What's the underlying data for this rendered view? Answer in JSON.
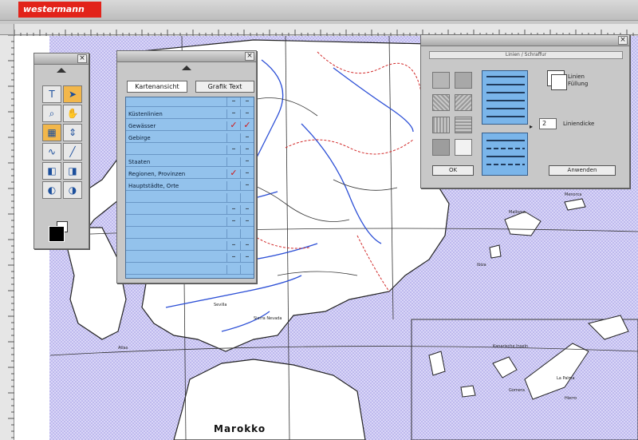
{
  "app": {
    "logo_text": "westermann",
    "brand_color": "#e2231a"
  },
  "map": {
    "label_morocco": "Marokko",
    "label_sevilla": "Sevilla",
    "label_sierra": "Sierra Nevada",
    "label_atlas": "Atlas",
    "label_canary": "Kanarische Inseln",
    "label_la_palma": "La Palma",
    "label_gomera": "Gomera",
    "label_hierro": "Hierro",
    "label_mallorca": "Mallorca",
    "label_menorca": "Menorca",
    "label_ibiza": "Ibiza",
    "hatch_color": "#c7c2f2",
    "river_color": "#2c4fd6",
    "border_color": "#d22b2b"
  },
  "tools_panel": {
    "close": "×",
    "tools": [
      {
        "name": "text-tool-icon",
        "glyph": "T",
        "active": false
      },
      {
        "name": "pointer-tool-icon",
        "glyph": "➤",
        "active": true
      },
      {
        "name": "zoom-tool-icon",
        "glyph": "⌕",
        "active": false
      },
      {
        "name": "hand-tool-icon",
        "glyph": "✋",
        "active": false
      },
      {
        "name": "grid-tool-icon",
        "glyph": "▦",
        "active": true
      },
      {
        "name": "move-tool-icon",
        "glyph": "⇕",
        "active": false
      },
      {
        "name": "curve-tool-icon",
        "glyph": "∿",
        "active": false
      },
      {
        "name": "line-tool-icon",
        "glyph": "╱",
        "active": false
      },
      {
        "name": "fill-left-tool-icon",
        "glyph": "◧",
        "active": false
      },
      {
        "name": "fill-right-tool-icon",
        "glyph": "◨",
        "active": false
      },
      {
        "name": "contrast-left-tool-icon",
        "glyph": "◐",
        "active": false
      },
      {
        "name": "contrast-right-tool-icon",
        "glyph": "◑",
        "active": false
      }
    ]
  },
  "layers_panel": {
    "close": "×",
    "tab_map": "Kartenansicht",
    "tab_graphic": "Grafik Text",
    "rows": [
      {
        "label": "",
        "c1": "–",
        "c2": "–",
        "check1": false,
        "check2": false
      },
      {
        "label": "Küstenlinien",
        "c1": "–",
        "c2": "–",
        "check1": false,
        "check2": false
      },
      {
        "label": "Gewässer",
        "c1": "✓",
        "c2": "✓",
        "check1": true,
        "check2": true
      },
      {
        "label": "Gebirge",
        "c1": "",
        "c2": "–",
        "check1": false,
        "check2": false
      },
      {
        "label": "",
        "c1": "–",
        "c2": "–",
        "check1": false,
        "check2": false
      },
      {
        "label": "Staaten",
        "c1": "",
        "c2": "–",
        "check1": false,
        "check2": false
      },
      {
        "label": "Regionen, Provinzen",
        "c1": "✓",
        "c2": "–",
        "check1": true,
        "check2": false
      },
      {
        "label": "Hauptstädte, Orte",
        "c1": "",
        "c2": "–",
        "check1": false,
        "check2": false
      },
      {
        "label": "",
        "c1": "",
        "c2": "",
        "check1": false,
        "check2": false
      },
      {
        "label": "",
        "c1": "–",
        "c2": "–",
        "check1": false,
        "check2": false
      },
      {
        "label": "",
        "c1": "–",
        "c2": "–",
        "check1": false,
        "check2": false
      },
      {
        "label": "",
        "c1": "",
        "c2": "",
        "check1": false,
        "check2": false
      },
      {
        "label": "",
        "c1": "–",
        "c2": "–",
        "check1": false,
        "check2": false
      },
      {
        "label": "",
        "c1": "–",
        "c2": "–",
        "check1": false,
        "check2": false
      },
      {
        "label": "",
        "c1": "",
        "c2": "",
        "check1": false,
        "check2": false
      }
    ]
  },
  "pattern_panel": {
    "close": "×",
    "title": "Linien / Schraffur",
    "random_label": "Linien Füllung",
    "stroke_value": "2",
    "stroke_label": "Liniendicke",
    "ok_label": "OK",
    "apply_label": "Anwenden"
  }
}
